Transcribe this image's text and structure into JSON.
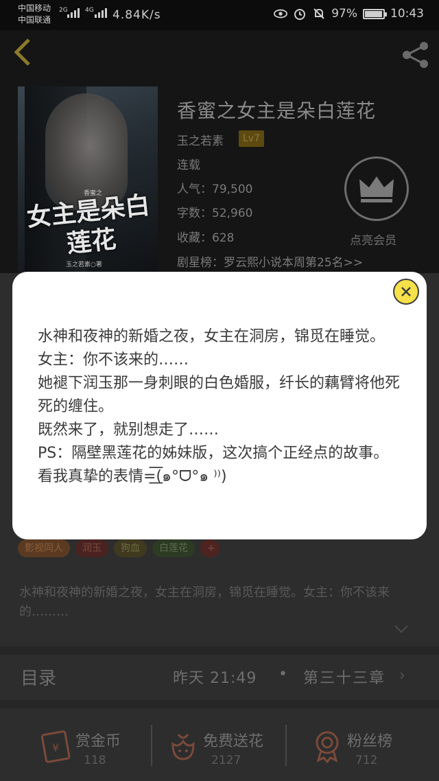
{
  "status_bar": {
    "carrier1": "中国移动",
    "carrier2": "中国联通",
    "net1": "2G",
    "net2": "4G",
    "speed": "4.84K/s",
    "battery": "97%",
    "time": "10:43"
  },
  "book": {
    "title": "香蜜之女主是朵白莲花",
    "author": "玉之若素",
    "level": "Lv7",
    "status": "连载",
    "popularity": "人气：79,500",
    "word_count": "字数：52,960",
    "favorites": "收藏：628",
    "ranking": "剧星榜：罗云熙小说本周第25名>>",
    "vip_label": "点亮会员",
    "cover_title": "女主是朵白莲花",
    "cover_series": "香蜜之",
    "cover_author": "玉之若素○著"
  },
  "tags": [
    "影视同人",
    "润玉",
    "狗血",
    "白莲花",
    "+"
  ],
  "summary": "水神和夜神的新婚之夜，女主在洞房，锦觅在睡觉。女主：你不该来的………",
  "toc": {
    "label": "目录",
    "time": "昨天 21:49",
    "dot": "•",
    "chapter": "第三十三章",
    "arrow": "›"
  },
  "actions": [
    {
      "label": "赏金币",
      "count": "118"
    },
    {
      "label": "免费送花",
      "count": "2127"
    },
    {
      "label": "粉丝榜",
      "count": "712"
    }
  ],
  "modal": {
    "lines": [
      "水神和夜神的新婚之夜，女主在洞房，锦觅在睡觉。",
      "女主：你不该来的……",
      "她褪下润玉那一身刺眼的白色婚服，纤长的藕臂将他死死的缠住。",
      "既然来了，就别想走了……",
      "PS：隔壁黑莲花的姊妹版，这次搞个正经点的故事。看我真挚的表情=͟͟͞͞(๑°ᗜ°๑ ⁾⁾)"
    ]
  },
  "colors": {
    "modal_bg": "#ffffff",
    "close_button": "#f6e14a",
    "level_badge": "#5e4a10"
  }
}
